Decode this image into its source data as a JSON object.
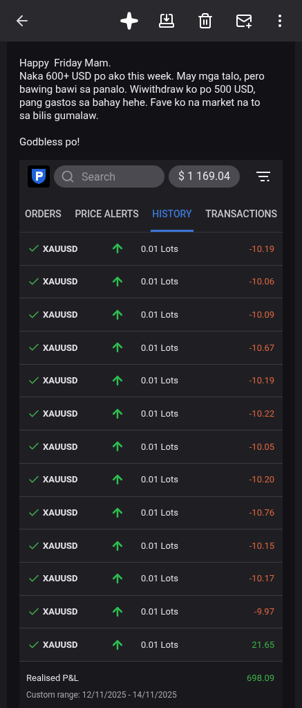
{
  "message": {
    "lines": [
      "Happy  Friday Mam.",
      "Naka 600+ USD po ako this week. May mga talo, pero bawing bawi sa panalo. Wiwithdraw ko po 500 USD, pang gastos sa bahay hehe. Fave ko na market na to sa bilis gumalaw."
    ],
    "closing": "Godbless po!"
  },
  "trade_app": {
    "search": {
      "placeholder": "Search"
    },
    "balance": "$ 1 169.04",
    "tabs": [
      {
        "label": "ORDERS",
        "selected": false
      },
      {
        "label": "PRICE ALERTS",
        "selected": false
      },
      {
        "label": "HISTORY",
        "selected": true
      },
      {
        "label": "TRANSACTIONS",
        "selected": false
      }
    ],
    "rows": [
      {
        "symbol": "XAUUSD",
        "volume": "0.01 Lots",
        "pnl": "-10.19",
        "kind": "loss"
      },
      {
        "symbol": "XAUUSD",
        "volume": "0.01 Lots",
        "pnl": "-10.06",
        "kind": "loss"
      },
      {
        "symbol": "XAUUSD",
        "volume": "0.01 Lots",
        "pnl": "-10.09",
        "kind": "loss"
      },
      {
        "symbol": "XAUUSD",
        "volume": "0.01 Lots",
        "pnl": "-10.67",
        "kind": "loss"
      },
      {
        "symbol": "XAUUSD",
        "volume": "0.01 Lots",
        "pnl": "-10.19",
        "kind": "loss"
      },
      {
        "symbol": "XAUUSD",
        "volume": "0.01 Lots",
        "pnl": "-10.22",
        "kind": "loss"
      },
      {
        "symbol": "XAUUSD",
        "volume": "0.01 Lots",
        "pnl": "-10.05",
        "kind": "loss"
      },
      {
        "symbol": "XAUUSD",
        "volume": "0.01 Lots",
        "pnl": "-10.20",
        "kind": "loss"
      },
      {
        "symbol": "XAUUSD",
        "volume": "0.01 Lots",
        "pnl": "-10.76",
        "kind": "loss"
      },
      {
        "symbol": "XAUUSD",
        "volume": "0.01 Lots",
        "pnl": "-10.15",
        "kind": "loss"
      },
      {
        "symbol": "XAUUSD",
        "volume": "0.01 Lots",
        "pnl": "-10.17",
        "kind": "loss"
      },
      {
        "symbol": "XAUUSD",
        "volume": "0.01 Lots",
        "pnl": "-9.97",
        "kind": "loss"
      },
      {
        "symbol": "XAUUSD",
        "volume": "0.01 Lots",
        "pnl": "21.65",
        "kind": "profit"
      }
    ],
    "summary": {
      "label": "Realised P&L",
      "value": "698.09",
      "kind": "profit",
      "range": "Custom range: 12/11/2025 - 14/11/2025"
    }
  }
}
